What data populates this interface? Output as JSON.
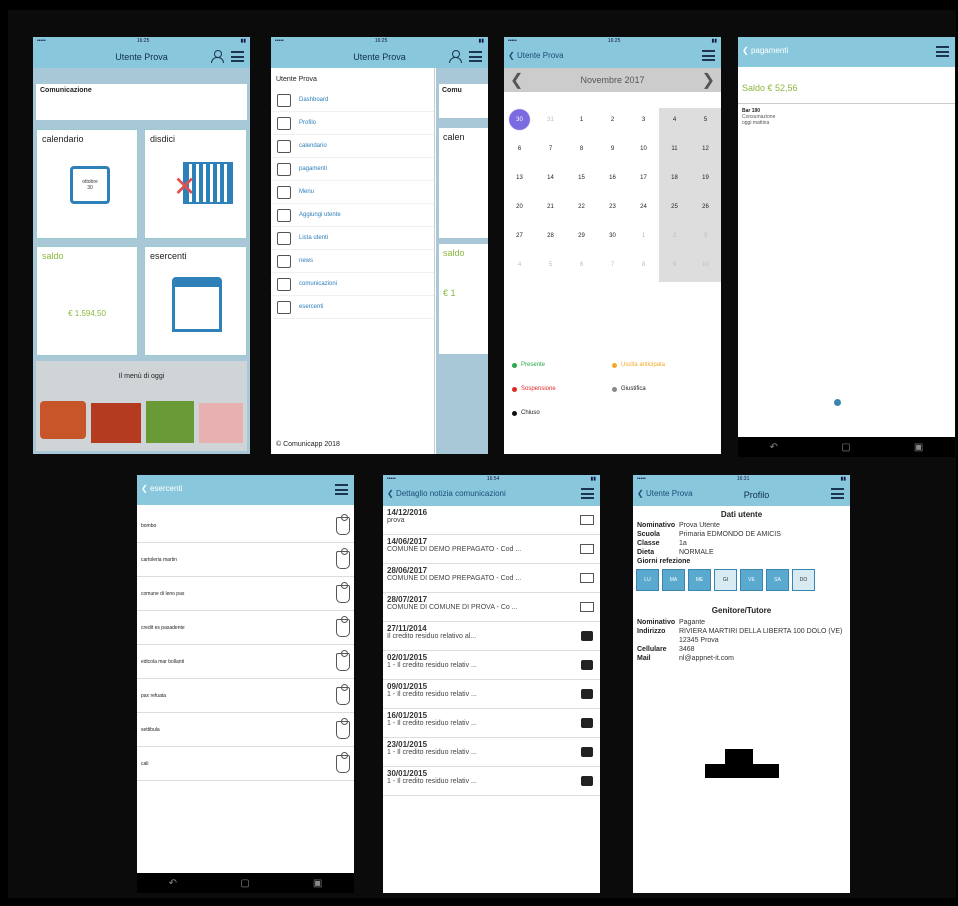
{
  "screen1": {
    "title": "Utente Prova",
    "comunicazioni": "Comunicazione",
    "tiles": [
      {
        "label": "calendario",
        "date_month": "ottobre",
        "date_day": "30"
      },
      {
        "label": "disdici"
      },
      {
        "label": "saldo",
        "value": "€ 1.594,50"
      },
      {
        "label": "esercenti"
      }
    ],
    "menu_banner": "Il menù di oggi"
  },
  "screen2": {
    "title": "Utente Prova",
    "header": "Utente Prova",
    "items": [
      "Dashboard",
      "Profilo",
      "calendario",
      "pagamenti",
      "Menu",
      "Aggiungi utente",
      "Lista utenti",
      "news",
      "comunicazioni",
      "esercenti"
    ],
    "footer": "© Comunicapp 2018",
    "peek_top": "Comu",
    "peek_cal": "calen",
    "peek_saldo": "saldo",
    "peek_val": "€ 1"
  },
  "screen3": {
    "back": "Utente Prova",
    "month": "Novembre 2017",
    "rows": [
      [
        "30",
        "31",
        "1",
        "2",
        "3",
        "4",
        "5"
      ],
      [
        "6",
        "7",
        "8",
        "9",
        "10",
        "11",
        "12"
      ],
      [
        "13",
        "14",
        "15",
        "16",
        "17",
        "18",
        "19"
      ],
      [
        "20",
        "21",
        "22",
        "23",
        "24",
        "25",
        "26"
      ],
      [
        "27",
        "28",
        "29",
        "30",
        "1",
        "2",
        "3"
      ],
      [
        "4",
        "5",
        "6",
        "7",
        "8",
        "9",
        "10"
      ]
    ],
    "legend": [
      {
        "label": "Presente",
        "color": "#2aa84a"
      },
      {
        "label": "Uscita anticipata",
        "color": "#f2a922"
      },
      {
        "label": "Sospensione",
        "color": "#e02828"
      },
      {
        "label": "Giustifica",
        "color": "#888888"
      },
      {
        "label": "Chiuso",
        "color": "#111111"
      }
    ]
  },
  "screen4": {
    "back": "pagamenti",
    "saldo": "Saldo € 52,56",
    "entry_title": "Bar 190",
    "entry_line1": "Consumazione",
    "entry_line2": "oggi mattina"
  },
  "screen5": {
    "back": "esercenti",
    "items": [
      "bombo",
      "cartoleria martin",
      "comune di leno pas",
      "credit es pasadente",
      "edicola mar bollanti",
      "pax refuata",
      "settibula",
      "cali"
    ]
  },
  "screen6": {
    "back": "Dettaglio notizia comunicazioni",
    "messages": [
      {
        "date": "14/12/2016",
        "text": "prova",
        "icon": "env"
      },
      {
        "date": "14/06/2017",
        "text": "COMUNE DI DEMO PREPAGATO - Cod ...",
        "icon": "env"
      },
      {
        "date": "28/06/2017",
        "text": "COMUNE DI DEMO PREPAGATO - Cod ...",
        "icon": "env"
      },
      {
        "date": "28/07/2017",
        "text": "COMUNE DI COMUNE DI PROVA - Co ...",
        "icon": "env"
      },
      {
        "date": "27/11/2014",
        "text": "Il credito residuo relativo al...",
        "icon": "bubble"
      },
      {
        "date": "02/01/2015",
        "text": "1 - Il credito residuo relativ ...",
        "icon": "bubble"
      },
      {
        "date": "09/01/2015",
        "text": "1 - Il credito residuo relativ ...",
        "icon": "bubble"
      },
      {
        "date": "16/01/2015",
        "text": "1 - Il credito residuo relativ ...",
        "icon": "bubble"
      },
      {
        "date": "23/01/2015",
        "text": "1 - Il credito residuo relativ ...",
        "icon": "bubble"
      },
      {
        "date": "30/01/2015",
        "text": "1 - Il credito residuo relativ ...",
        "icon": "bubble"
      }
    ]
  },
  "screen7": {
    "back": "Utente Prova",
    "title": "Profilo",
    "section1": "Dati utente",
    "rows1": [
      {
        "k": "Nominativo",
        "v": "Prova Utente"
      },
      {
        "k": "Scuola",
        "v": "Primaria EDMONDO DE AMICIS"
      },
      {
        "k": "Classe",
        "v": "1a"
      },
      {
        "k": "Dieta",
        "v": "NORMALE"
      }
    ],
    "giorni_label": "Giorni refezione",
    "days": [
      {
        "label": "LU",
        "on": true
      },
      {
        "label": "MA",
        "on": true
      },
      {
        "label": "ME",
        "on": true
      },
      {
        "label": "GI",
        "on": false
      },
      {
        "label": "VE",
        "on": true
      },
      {
        "label": "SA",
        "on": true
      },
      {
        "label": "DO",
        "on": false
      }
    ],
    "section2": "Genitore/Tutore",
    "rows2": [
      {
        "k": "Nominativo",
        "v": "Pagante"
      },
      {
        "k": "Indirizzo",
        "v": "RIVIERA MARTIRI DELLA LIBERTA 100 DOLO (VE)"
      },
      {
        "k": "",
        "v": "12345 Prova"
      },
      {
        "k": "Cellulare",
        "v": "3468"
      },
      {
        "k": "Mail",
        "v": "nl@appnet-it.com"
      }
    ]
  }
}
